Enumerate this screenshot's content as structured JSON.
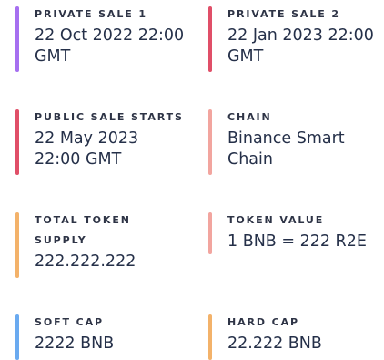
{
  "details": [
    {
      "label": "PRIVATE SALE 1",
      "value_lines": [
        "22 Oct 2022 22:00",
        "GMT"
      ],
      "accent": "#a66ff0"
    },
    {
      "label": "PRIVATE SALE 2",
      "value_lines": [
        "22 Jan 2023 22:00",
        "GMT"
      ],
      "accent": "#e04f68"
    },
    {
      "label": "PUBLIC SALE STARTS",
      "value_lines": [
        "22 May 2023",
        "22:00 GMT"
      ],
      "accent": "#e04f68"
    },
    {
      "label": "CHAIN",
      "value_lines": [
        "Binance Smart",
        "Chain"
      ],
      "accent": "#f2a59f"
    },
    {
      "label_lines": [
        "TOTAL TOKEN",
        "SUPPLY"
      ],
      "value_lines": [
        "222.222.222"
      ],
      "accent": "#f3b26a"
    },
    {
      "label": "TOKEN VALUE",
      "value_lines": [
        "1 BNB = 222 R2E"
      ],
      "accent": "#f2a59f"
    },
    {
      "label": "SOFT CAP",
      "value_lines": [
        "2222 BNB"
      ],
      "accent": "#6aaaf0"
    },
    {
      "label": "HARD CAP",
      "value_lines": [
        "22.222 BNB"
      ],
      "accent": "#f3b26a"
    }
  ]
}
